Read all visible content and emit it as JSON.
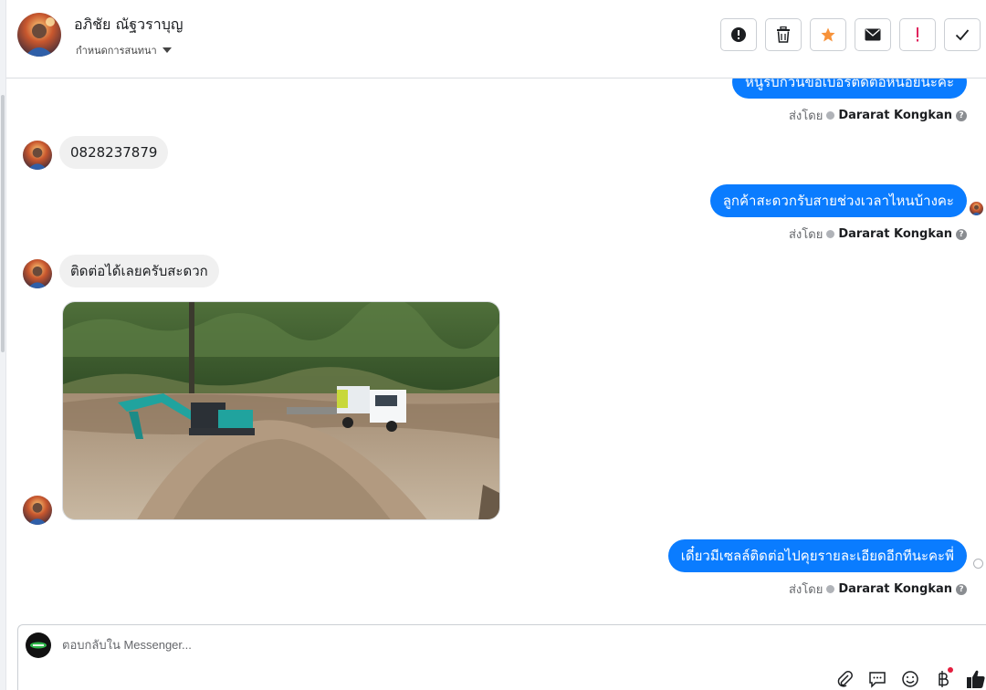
{
  "header": {
    "contact_name": "อภิชัย ณัฐวราบุญ",
    "thread_label": "กำหนดการสนทนา"
  },
  "toolbar": {
    "buttons": [
      {
        "icon": "alert-circle-icon"
      },
      {
        "icon": "trash-icon"
      },
      {
        "icon": "star-icon",
        "color": "#f7923a"
      },
      {
        "icon": "envelope-icon"
      },
      {
        "icon": "exclamation-icon",
        "color": "#e0245e"
      },
      {
        "icon": "checkmark-icon"
      }
    ]
  },
  "messages": {
    "m1": {
      "direction": "outgoing",
      "text": "หนูรบกวนขอเบอร์ติดต่อหน่อยนะคะ"
    },
    "m1_status": {
      "prefix": "ส่งโดย",
      "sender": "Dararat Kongkan",
      "help": "?"
    },
    "m2": {
      "direction": "incoming",
      "text": "0828237879"
    },
    "m3": {
      "direction": "outgoing",
      "text": "ลูกค้าสะดวกรับสายช่วงเวลาไหนบ้างคะ"
    },
    "m3_status": {
      "prefix": "ส่งโดย",
      "sender": "Dararat Kongkan",
      "help": "?"
    },
    "m4": {
      "direction": "incoming",
      "text": "ติดต่อได้เลยครับสะดวก"
    },
    "m5": {
      "direction": "incoming",
      "type": "photo"
    },
    "m6": {
      "direction": "outgoing",
      "text": "เดี๋ยวมีเซลล์ติดต่อไปคุยรายละเอียดอีกทีนะคะพี่"
    },
    "m6_status": {
      "prefix": "ส่งโดย",
      "sender": "Dararat Kongkan",
      "help": "?"
    }
  },
  "composer": {
    "placeholder": "ตอบกลับใน Messenger...",
    "tools": [
      "paperclip-icon",
      "message-icon",
      "smiley-icon",
      "baht-icon",
      "thumbs-up-icon"
    ]
  },
  "colors": {
    "outgoing_bubble": "#0a7cff",
    "incoming_bubble": "#f0f0f0",
    "accent_star": "#f7923a",
    "alert_red": "#e0245e"
  }
}
